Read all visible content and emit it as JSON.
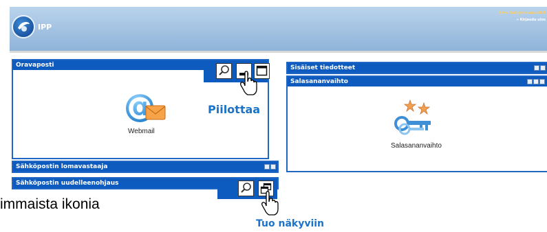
{
  "header": {
    "logo_text": "IPP",
    "user_text": "Eeva Salo@oravaposti.fi",
    "logout_text": "» Kirjaudu ulos"
  },
  "portlets": {
    "oravaposti": {
      "title": "Oravaposti",
      "app_label": "Webmail"
    },
    "sisaiset": {
      "title": "Sisäiset tiedotteet"
    },
    "salasana": {
      "title": "Salasananvaihto",
      "app_label": "Salasananvaihto"
    },
    "lomavastaaja": {
      "title": "Sähköpostin lomavastaaja"
    },
    "uudelleenohjaus": {
      "title": "Sähköpostin uudelleenohjaus"
    }
  },
  "annotations": {
    "hide": "Piilottaa",
    "show": "Tuo näkyviin",
    "partial_text": "immaista ikonia"
  },
  "colors": {
    "bar": "#0d5bbe",
    "border": "#2066c4",
    "callout": "#1a73c8"
  },
  "icons": [
    "search-icon",
    "minimize-icon",
    "maximize-icon",
    "restore-icon",
    "hand-cursor-icon",
    "webmail-icon",
    "keys-icon"
  ]
}
